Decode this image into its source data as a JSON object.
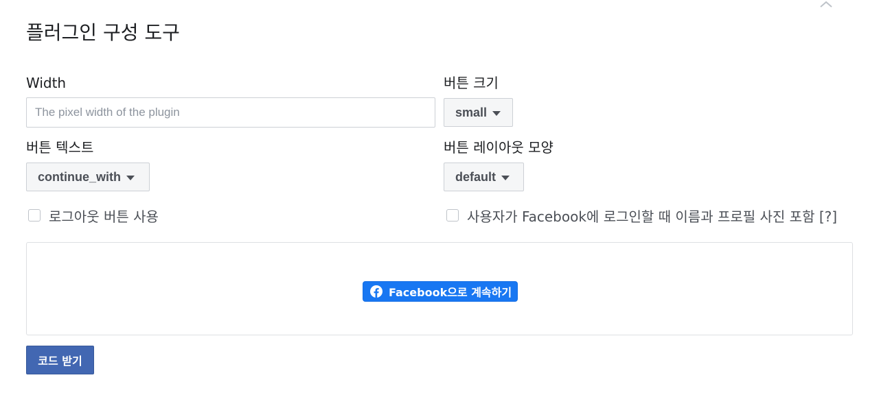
{
  "header": {
    "title": "플러그인 구성 도구",
    "collapse_icon": "chevron-up-icon"
  },
  "form": {
    "width": {
      "label": "Width",
      "value": "",
      "placeholder": "The pixel width of the plugin"
    },
    "button_size": {
      "label": "버튼 크기",
      "selected": "small"
    },
    "button_text": {
      "label": "버튼 텍스트",
      "selected": "continue_with"
    },
    "button_layout": {
      "label": "버튼 레이아웃 모양",
      "selected": "default"
    },
    "logout_checkbox": {
      "label": "로그아웃 버튼 사용",
      "checked": false
    },
    "profile_checkbox": {
      "label": "사용자가 Facebook에 로그인할 때 이름과 프로필 사진 포함 [?]",
      "checked": false
    }
  },
  "preview": {
    "button_label": "Facebook으로 계속하기",
    "button_icon": "facebook-logo-icon",
    "brand_color": "#1877f2"
  },
  "actions": {
    "get_code_label": "코드 받기",
    "accent_color": "#4267b2"
  }
}
